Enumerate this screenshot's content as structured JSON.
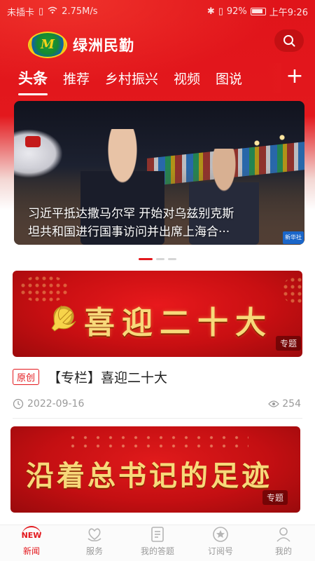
{
  "status_bar": {
    "carrier": "未插卡",
    "speed": "2.75M/s",
    "battery": "92%",
    "time": "上午9:26"
  },
  "header": {
    "app_name": "绿洲民勤",
    "search_icon": "search-icon",
    "add_icon": "plus-icon"
  },
  "tabs": [
    "头条",
    "推荐",
    "乡村振兴",
    "视频",
    "图说"
  ],
  "hero": {
    "caption_line1": "习近平抵达撒马尔罕 开始对乌兹别克斯",
    "caption_line2": "坦共和国进行国事访问并出席上海合···",
    "badge": "新华社"
  },
  "banner1": {
    "title": "喜迎二十大",
    "tag": "专题"
  },
  "article": {
    "badge": "原创",
    "title": "【专栏】喜迎二十大",
    "date": "2022-09-16",
    "views": "254"
  },
  "banner2": {
    "title": "沿着总书记的足迹",
    "tag": "专题"
  },
  "bottom_nav": [
    {
      "label": "新闻",
      "icon": "news-icon"
    },
    {
      "label": "服务",
      "icon": "heart-hand-icon"
    },
    {
      "label": "我的答题",
      "icon": "quiz-icon"
    },
    {
      "label": "订阅号",
      "icon": "star-badge-icon"
    },
    {
      "label": "我的",
      "icon": "user-icon"
    }
  ],
  "colors": {
    "brand_red": "#e3181d",
    "gold_text": "#f7d97a"
  }
}
